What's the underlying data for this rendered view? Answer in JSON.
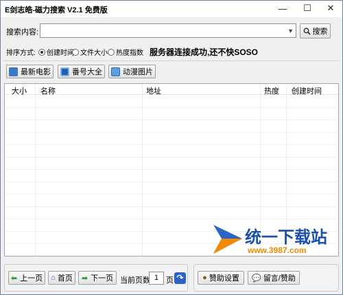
{
  "window": {
    "title": "E剑志皓-磁力搜索 V2.1 免费版",
    "minimize": "—",
    "maximize": "☐",
    "close": "✕"
  },
  "search": {
    "label": "搜索内容:",
    "value": "",
    "button_label": "搜索"
  },
  "sort": {
    "label": "排序方式:",
    "options": [
      "创建时间",
      "文件大小",
      "热度指数"
    ],
    "selected": "创建时间",
    "status_text": "服务器连接成功,还不快SOSO"
  },
  "toolbar": {
    "buttons": [
      "最新电影",
      "番号大全",
      "动漫图片"
    ]
  },
  "table": {
    "columns": [
      "大小",
      "名称",
      "地址",
      "热度",
      "创建时间"
    ],
    "rows": []
  },
  "pager": {
    "prev_label": "上一页",
    "home_label": "首页",
    "next_label": "下一页",
    "current_page_label": "当前页数:",
    "current_page": "1",
    "page_unit": "页"
  },
  "actions": {
    "sponsor_settings": "赞助设置",
    "message_sponsor": "留言/赞助"
  },
  "watermark": {
    "name": "统一下载站",
    "url": "www.3987.com"
  },
  "colors": {
    "accent_blue": "#2a64c4",
    "watermark_blue": "#1b4fa8",
    "watermark_orange": "#f08a00"
  }
}
